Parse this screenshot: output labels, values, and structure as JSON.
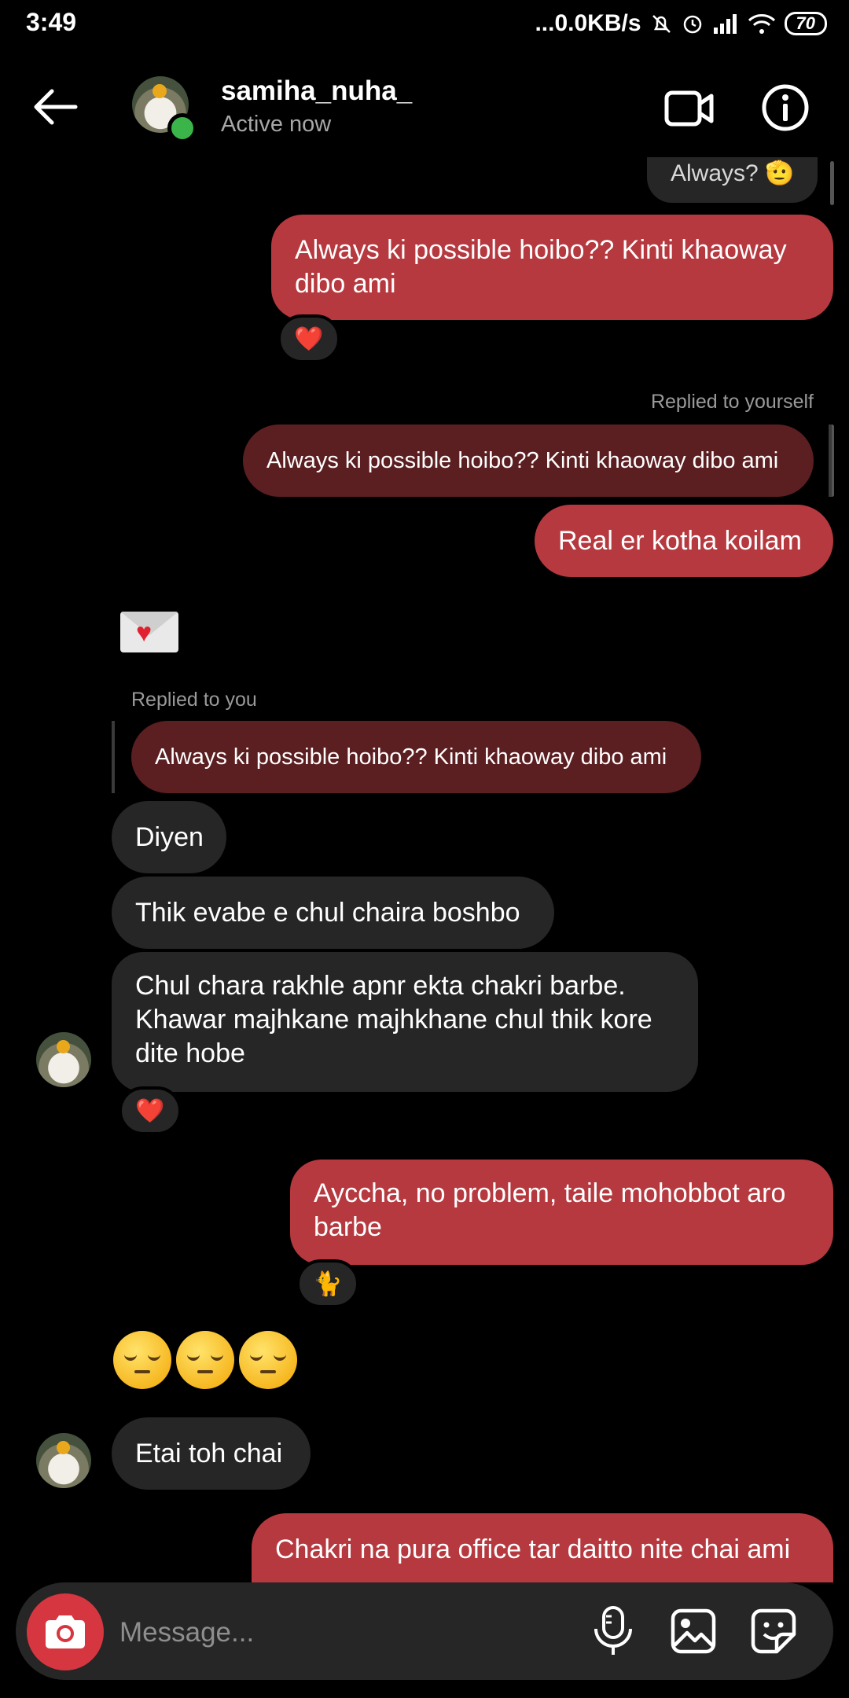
{
  "status_bar": {
    "time": "3:49",
    "network_speed": "...0.0KB/s",
    "battery": "70"
  },
  "header": {
    "username": "samiha_nuha_",
    "status": "Active now",
    "icons": [
      "back-arrow-icon",
      "video-call-icon",
      "info-icon"
    ]
  },
  "messages": {
    "m0_partial": "Always? 🫡",
    "m1": "Always ki possible hoibo?? Kinti khaoway dibo ami",
    "m1_reaction": "❤️",
    "m2_reply_label": "Replied to yourself",
    "m2_quote": "Always ki possible hoibo?? Kinti khaoway dibo ami",
    "m2_text": "Real er kotha koilam",
    "m3_reply_label": "Replied to you",
    "m3_quote": "Always ki possible hoibo?? Kinti khaoway dibo ami",
    "m4": "Diyen",
    "m5": "Thik evabe e chul chaira boshbo",
    "m6_line1": "Chul chara rakhle apnr ekta chakri barbe.",
    "m6_line2": "Khawar majhkane majhkhane chul thik kore",
    "m6_line3": "dite hobe",
    "m6_reaction": "❤️",
    "m7_line1": "Ayccha, no problem, taile mohobbot aro",
    "m7_line2": "barbe",
    "m7_reaction": "🐈",
    "m9": "Etai toh chai",
    "m10": "Chakri na pura office tar daitto nite chai ami"
  },
  "composer": {
    "placeholder": "Message...",
    "icons": [
      "camera-icon",
      "microphone-icon",
      "gallery-icon",
      "sticker-icon"
    ]
  },
  "colors": {
    "sent_bubble": "#b5393f",
    "received_bubble": "#262626",
    "quote_bubble": "#5b1e21",
    "camera_button": "#d6363f",
    "online_dot": "#3bb54a"
  }
}
